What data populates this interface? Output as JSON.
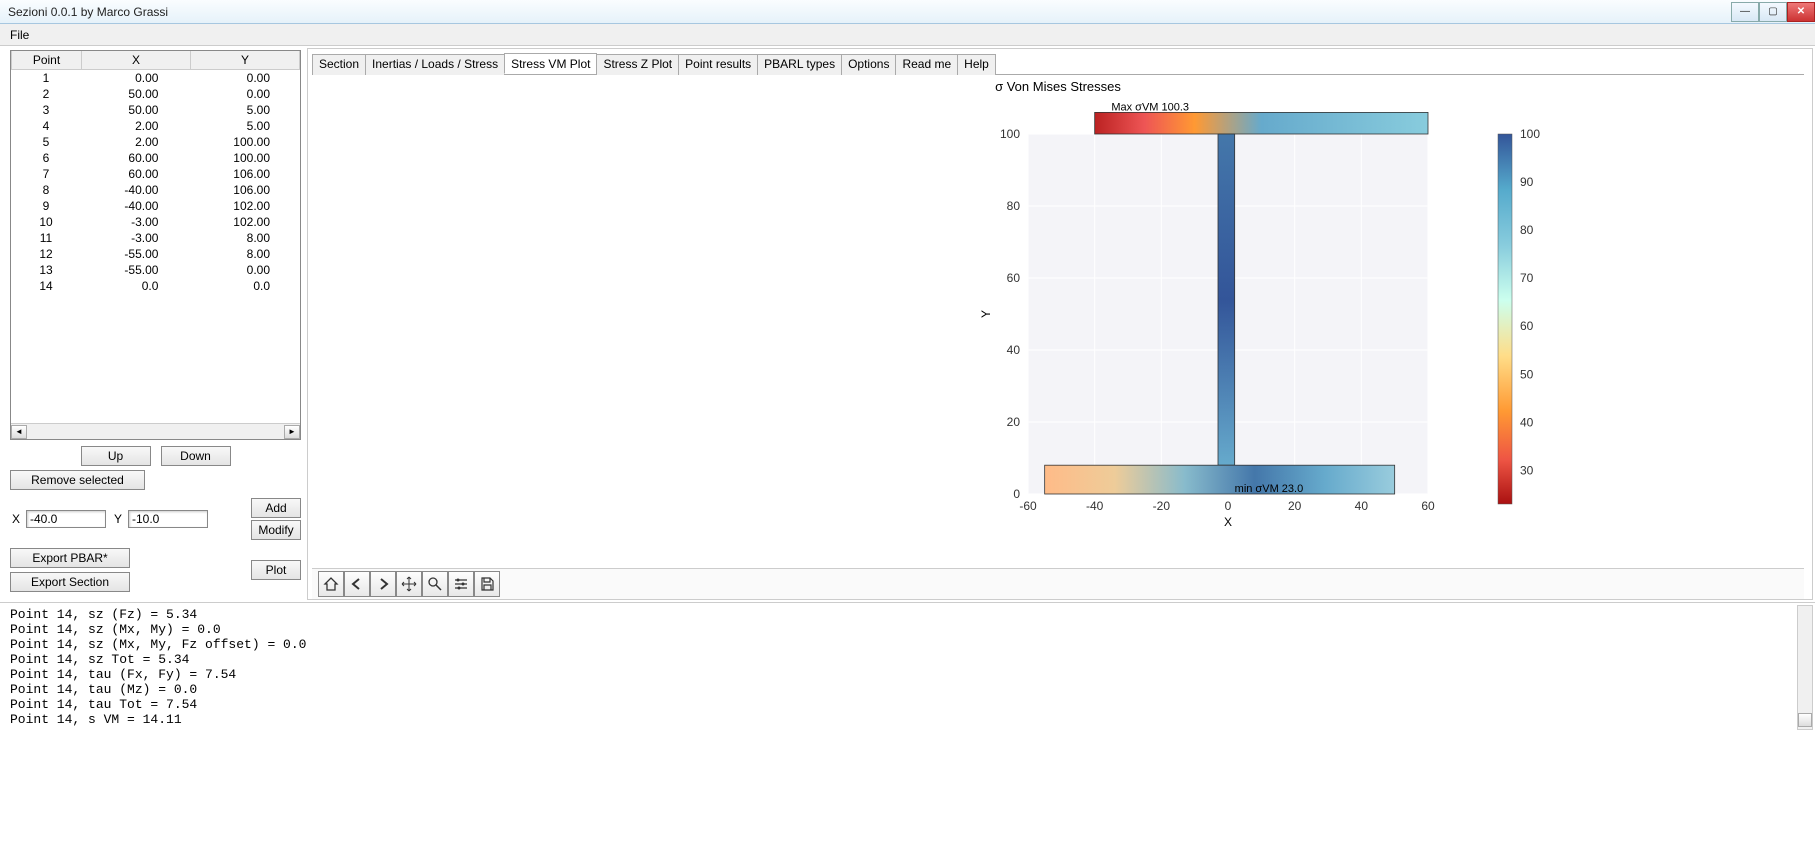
{
  "window": {
    "title": "Sezioni 0.0.1 by Marco Grassi"
  },
  "menubar": {
    "file": "File"
  },
  "table": {
    "headers": {
      "point": "Point",
      "x": "X",
      "y": "Y"
    },
    "rows": [
      {
        "p": "1",
        "x": "0.00",
        "y": "0.00"
      },
      {
        "p": "2",
        "x": "50.00",
        "y": "0.00"
      },
      {
        "p": "3",
        "x": "50.00",
        "y": "5.00"
      },
      {
        "p": "4",
        "x": "2.00",
        "y": "5.00"
      },
      {
        "p": "5",
        "x": "2.00",
        "y": "100.00"
      },
      {
        "p": "6",
        "x": "60.00",
        "y": "100.00"
      },
      {
        "p": "7",
        "x": "60.00",
        "y": "106.00"
      },
      {
        "p": "8",
        "x": "-40.00",
        "y": "106.00"
      },
      {
        "p": "9",
        "x": "-40.00",
        "y": "102.00"
      },
      {
        "p": "10",
        "x": "-3.00",
        "y": "102.00"
      },
      {
        "p": "11",
        "x": "-3.00",
        "y": "8.00"
      },
      {
        "p": "12",
        "x": "-55.00",
        "y": "8.00"
      },
      {
        "p": "13",
        "x": "-55.00",
        "y": "0.00"
      },
      {
        "p": "14",
        "x": "0.0",
        "y": "0.0"
      }
    ]
  },
  "buttons": {
    "up": "Up",
    "down": "Down",
    "remove": "Remove selected",
    "add": "Add",
    "modify": "Modify",
    "export_pbar": "Export PBAR*",
    "export_section": "Export Section",
    "plot": "Plot"
  },
  "inputs": {
    "x_label": "X",
    "y_label": "Y",
    "x_value": "-40.0",
    "y_value": "-10.0"
  },
  "tabs": {
    "section": "Section",
    "inertias": "Inertias / Loads / Stress",
    "vm": "Stress VM Plot",
    "z": "Stress Z Plot",
    "point_results": "Point results",
    "pbarl": "PBARL types",
    "options": "Options",
    "readme": "Read me",
    "help": "Help"
  },
  "chart_data": {
    "type": "heatmap",
    "title": "σ Von Mises Stresses",
    "xlabel": "X",
    "ylabel": "Y",
    "xlim": [
      -60,
      60
    ],
    "ylim": [
      0,
      100
    ],
    "xticks": [
      -60,
      -40,
      -20,
      0,
      20,
      40,
      60
    ],
    "yticks": [
      0,
      20,
      40,
      60,
      80,
      100
    ],
    "colorbar_ticks": [
      30,
      40,
      50,
      60,
      70,
      80,
      90,
      100
    ],
    "annotations": {
      "max": "Max σVM 100.3",
      "min": "min σVM 23.0"
    }
  },
  "console_lines": [
    "Point 14, sz (Fz) = 5.34",
    "Point 14, sz (Mx, My) = 0.0",
    "Point 14, sz (Mx, My, Fz offset) = 0.0",
    "Point 14, sz Tot = 5.34",
    "Point 14, tau (Fx, Fy) = 7.54",
    "Point 14, tau (Mz) = 0.0",
    "Point 14, tau Tot = 7.54",
    "Point 14, s VM = 14.11"
  ]
}
